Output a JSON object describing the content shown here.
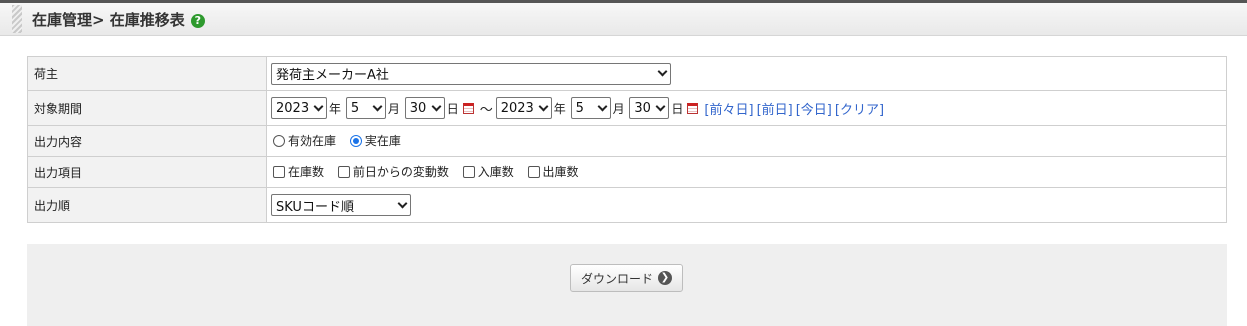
{
  "header": {
    "title": "在庫管理> 在庫推移表",
    "help_icon": "question-circle-icon"
  },
  "form": {
    "shipper": {
      "label": "荷主",
      "value": "発荷主メーカーA社"
    },
    "period": {
      "label": "対象期間",
      "from": {
        "year": "2023",
        "month": "5",
        "day": "30"
      },
      "to": {
        "year": "2023",
        "month": "5",
        "day": "30"
      },
      "year_unit": "年",
      "month_unit": "月",
      "day_unit": "日",
      "tilde": "～",
      "links": [
        "[前々日]",
        "[前日]",
        "[今日]",
        "[クリア]"
      ]
    },
    "content": {
      "label": "出力内容",
      "options": [
        {
          "label": "有効在庫",
          "checked": false
        },
        {
          "label": "実在庫",
          "checked": true
        }
      ]
    },
    "items": {
      "label": "出力項目",
      "options": [
        {
          "label": "在庫数",
          "checked": false
        },
        {
          "label": "前日からの変動数",
          "checked": false
        },
        {
          "label": "入庫数",
          "checked": false
        },
        {
          "label": "出庫数",
          "checked": false
        }
      ]
    },
    "order": {
      "label": "出力順",
      "value": "SKUコード順"
    }
  },
  "footer": {
    "download_label": "ダウンロード",
    "download_icon": "arrow-right-circle-icon"
  },
  "colors": {
    "link": "#3366cc",
    "help": "#2e9a2e",
    "radio_on": "#1a73e8"
  }
}
